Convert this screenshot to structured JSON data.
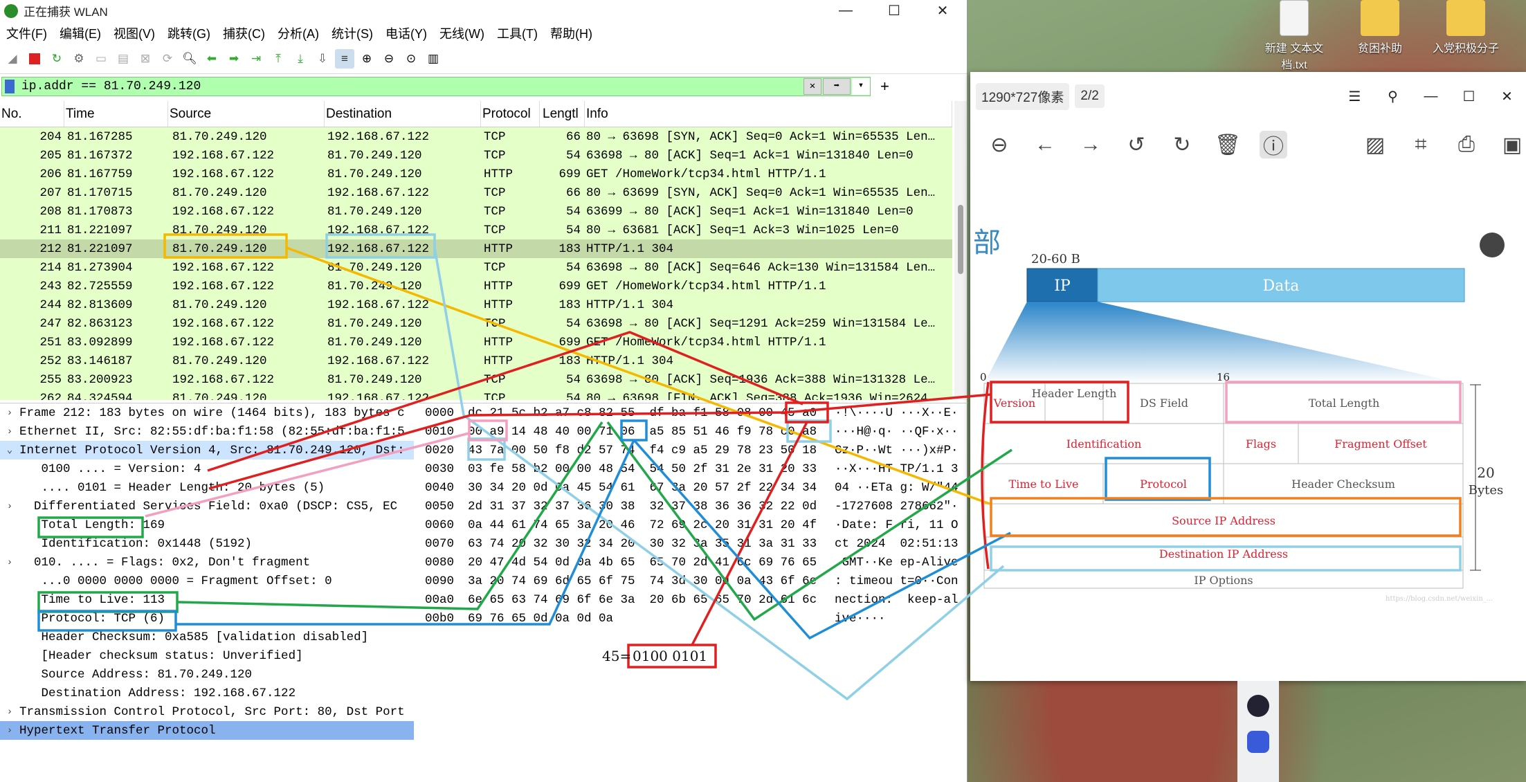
{
  "wireshark": {
    "title": "正在捕获 WLAN",
    "menu": [
      "文件(F)",
      "编辑(E)",
      "视图(V)",
      "跳转(G)",
      "捕获(C)",
      "分析(A)",
      "统计(S)",
      "电话(Y)",
      "无线(W)",
      "工具(T)",
      "帮助(H)"
    ],
    "filter": "ip.addr == 81.70.249.120",
    "columns": [
      "No.",
      "Time",
      "Source",
      "Destination",
      "Protocol",
      "Lengtl",
      "Info"
    ],
    "packets": [
      {
        "no": "204",
        "time": "81.167285",
        "src": "81.70.249.120",
        "dst": "192.168.67.122",
        "proto": "TCP",
        "len": "66",
        "info": "80 → 63698 [SYN, ACK] Seq=0 Ack=1 Win=65535 Len…"
      },
      {
        "no": "205",
        "time": "81.167372",
        "src": "192.168.67.122",
        "dst": "81.70.249.120",
        "proto": "TCP",
        "len": "54",
        "info": "63698 → 80 [ACK] Seq=1 Ack=1 Win=131840 Len=0"
      },
      {
        "no": "206",
        "time": "81.167759",
        "src": "192.168.67.122",
        "dst": "81.70.249.120",
        "proto": "HTTP",
        "len": "699",
        "info": "GET /HomeWork/tcp34.html HTTP/1.1"
      },
      {
        "no": "207",
        "time": "81.170715",
        "src": "81.70.249.120",
        "dst": "192.168.67.122",
        "proto": "TCP",
        "len": "66",
        "info": "80 → 63699 [SYN, ACK] Seq=0 Ack=1 Win=65535 Len…"
      },
      {
        "no": "208",
        "time": "81.170873",
        "src": "192.168.67.122",
        "dst": "81.70.249.120",
        "proto": "TCP",
        "len": "54",
        "info": "63699 → 80 [ACK] Seq=1 Ack=1 Win=131840 Len=0"
      },
      {
        "no": "211",
        "time": "81.221097",
        "src": "81.70.249.120",
        "dst": "192.168.67.122",
        "proto": "TCP",
        "len": "54",
        "info": "80 → 63681 [ACK] Seq=1 Ack=3 Win=1025 Len=0"
      },
      {
        "no": "212",
        "time": "81.221097",
        "src": "81.70.249.120",
        "dst": "192.168.67.122",
        "proto": "HTTP",
        "len": "183",
        "info": "HTTP/1.1 304",
        "selected": true
      },
      {
        "no": "214",
        "time": "81.273904",
        "src": "192.168.67.122",
        "dst": "81.70.249.120",
        "proto": "TCP",
        "len": "54",
        "info": "63698 → 80 [ACK] Seq=646 Ack=130 Win=131584 Len…"
      },
      {
        "no": "243",
        "time": "82.725559",
        "src": "192.168.67.122",
        "dst": "81.70.249.120",
        "proto": "HTTP",
        "len": "699",
        "info": "GET /HomeWork/tcp34.html HTTP/1.1"
      },
      {
        "no": "244",
        "time": "82.813609",
        "src": "81.70.249.120",
        "dst": "192.168.67.122",
        "proto": "HTTP",
        "len": "183",
        "info": "HTTP/1.1 304"
      },
      {
        "no": "247",
        "time": "82.863123",
        "src": "192.168.67.122",
        "dst": "81.70.249.120",
        "proto": "TCP",
        "len": "54",
        "info": "63698 → 80 [ACK] Seq=1291 Ack=259 Win=131584 Le…"
      },
      {
        "no": "251",
        "time": "83.092899",
        "src": "192.168.67.122",
        "dst": "81.70.249.120",
        "proto": "HTTP",
        "len": "699",
        "info": "GET /HomeWork/tcp34.html HTTP/1.1"
      },
      {
        "no": "252",
        "time": "83.146187",
        "src": "81.70.249.120",
        "dst": "192.168.67.122",
        "proto": "HTTP",
        "len": "183",
        "info": "HTTP/1.1 304"
      },
      {
        "no": "255",
        "time": "83.200923",
        "src": "192.168.67.122",
        "dst": "81.70.249.120",
        "proto": "TCP",
        "len": "54",
        "info": "63698 → 80 [ACK] Seq=1936 Ack=388 Win=131328 Le…"
      },
      {
        "no": "262",
        "time": "84.324594",
        "src": "81.70.249.120",
        "dst": "192.168.67.122",
        "proto": "TCP",
        "len": "54",
        "info": "80 → 63698 [FIN, ACK] Seq=388 Ack=1936 Win=2624…"
      }
    ],
    "details": [
      {
        "tw": "›",
        "text": "Frame 212: 183 bytes on wire (1464 bits), 183 bytes c"
      },
      {
        "tw": "›",
        "text": "Ethernet II, Src: 82:55:df:ba:f1:58 (82:55:df:ba:f1:5"
      },
      {
        "tw": "⌄",
        "text": "Internet Protocol Version 4, Src: 81.70.249.120, Dst:",
        "cls": "hl"
      },
      {
        "tw": "",
        "text": "   0100 .... = Version: 4"
      },
      {
        "tw": "",
        "text": "   .... 0101 = Header Length: 20 bytes (5)"
      },
      {
        "tw": "›",
        "text": "  Differentiated Services Field: 0xa0 (DSCP: CS5, EC"
      },
      {
        "tw": "",
        "text": "   Total Length: 169"
      },
      {
        "tw": "",
        "text": "   Identification: 0x1448 (5192)"
      },
      {
        "tw": "›",
        "text": "  010. .... = Flags: 0x2, Don't fragment"
      },
      {
        "tw": "",
        "text": "   ...0 0000 0000 0000 = Fragment Offset: 0"
      },
      {
        "tw": "",
        "text": "   Time to Live: 113"
      },
      {
        "tw": "",
        "text": "   Protocol: TCP (6)"
      },
      {
        "tw": "",
        "text": "   Header Checksum: 0xa585 [validation disabled]"
      },
      {
        "tw": "",
        "text": "   [Header checksum status: Unverified]"
      },
      {
        "tw": "",
        "text": "   Source Address: 81.70.249.120"
      },
      {
        "tw": "",
        "text": "   Destination Address: 192.168.67.122"
      },
      {
        "tw": "›",
        "text": "Transmission Control Protocol, Src Port: 80, Dst Port"
      },
      {
        "tw": "›",
        "text": "Hypertext Transfer Protocol",
        "cls": "hl2"
      }
    ],
    "hex": [
      {
        "off": "0000",
        "bytes": "dc 21 5c b2 a7 c8 82 55  df ba f1 58 08 00 45 a0",
        "ascii": "·!\\····U ···X··E·"
      },
      {
        "off": "0010",
        "bytes": "00 a9 14 48 40 00 71 06  a5 85 51 46 f9 78 c0 a8",
        "ascii": "···H@·q· ··QF·x··"
      },
      {
        "off": "0020",
        "bytes": "43 7a 00 50 f8 d2 57 74  f4 c9 a5 29 78 23 50 18",
        "ascii": "Cz·P··Wt ···)x#P·"
      },
      {
        "off": "0030",
        "bytes": "03 fe 58 b2 00 00 48 54  54 50 2f 31 2e 31 20 33",
        "ascii": "··X···HT TP/1.1 3"
      },
      {
        "off": "0040",
        "bytes": "30 34 20 0d 0a 45 54 61  67 3a 20 57 2f 22 34 34",
        "ascii": "04 ··ETa g: W/\"44"
      },
      {
        "off": "0050",
        "bytes": "2d 31 37 32 37 36 30 38  32 37 38 36 36 32 22 0d",
        "ascii": "-1727608 278662\"·"
      },
      {
        "off": "0060",
        "bytes": "0a 44 61 74 65 3a 20 46  72 69 2c 20 31 31 20 4f",
        "ascii": "·Date: F ri, 11 O"
      },
      {
        "off": "0070",
        "bytes": "63 74 20 32 30 32 34 20  30 32 3a 35 31 3a 31 33",
        "ascii": "ct 2024  02:51:13"
      },
      {
        "off": "0080",
        "bytes": "20 47 4d 54 0d 0a 4b 65  65 70 2d 41 6c 69 76 65",
        "ascii": " GMT··Ke ep-Alive"
      },
      {
        "off": "0090",
        "bytes": "3a 20 74 69 6d 65 6f 75  74 3d 30 0d 0a 43 6f 6e",
        "ascii": ": timeou t=0··Con"
      },
      {
        "off": "00a0",
        "bytes": "6e 65 63 74 69 6f 6e 3a  20 6b 65 65 70 2d 61 6c",
        "ascii": "nection:  keep-al"
      },
      {
        "off": "00b0",
        "bytes": "69 76 65 0d 0a 0d 0a",
        "ascii": "ive····"
      }
    ],
    "annotation_45": "45=",
    "annotation_bits": "0100 0101"
  },
  "viewer": {
    "size": "1290*727像素",
    "page": "2/2",
    "heading_char": "部",
    "diagram": {
      "size_label": "20-60 B",
      "ip_label": "IP",
      "data_label": "Data",
      "bit0": "0",
      "bit16": "16",
      "fields": [
        "Version",
        "Header Length",
        "DS Field",
        "Total Length",
        "Identification",
        "Flags",
        "Fragment Offset",
        "Time to Live",
        "Protocol",
        "Header Checksum",
        "Source IP Address",
        "Destination IP Address",
        "IP  Options"
      ],
      "bytes_num": "20",
      "bytes_unit": "Bytes",
      "watermark": "https://blog.csdn.net/weixin_..."
    }
  },
  "desktop": {
    "icons": [
      "新建 文本文档.txt",
      "贫困补助",
      "入党积极分子"
    ]
  },
  "colors": {
    "red": "#e02020",
    "yellow": "#f5b800",
    "lightblue": "#8fd0e6",
    "green": "#22a84a",
    "blue": "#1f8ed6",
    "pink": "#f3a0c0",
    "orange": "#f0801e"
  }
}
